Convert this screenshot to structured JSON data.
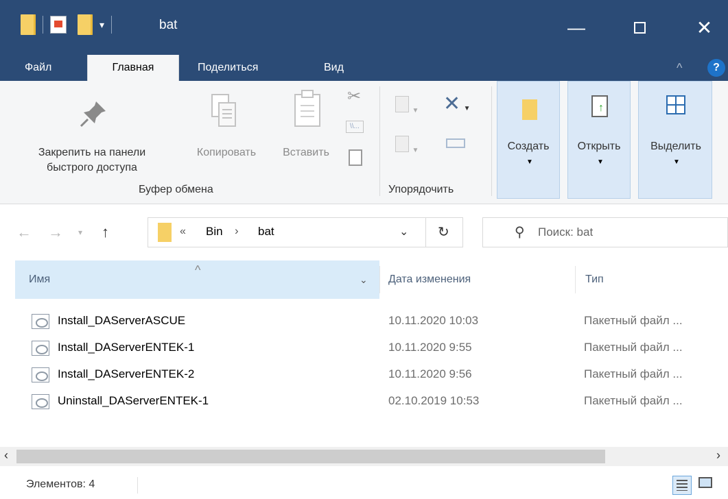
{
  "window": {
    "title": "bat"
  },
  "menu": {
    "tabs": [
      {
        "label": "Файл"
      },
      {
        "label": "Главная"
      },
      {
        "label": "Поделиться"
      },
      {
        "label": "Вид"
      }
    ]
  },
  "ribbon": {
    "clipboard": {
      "pin_label_line1": "Закрепить на панели",
      "pin_label_line2": "быстрого доступа",
      "copy_label": "Копировать",
      "paste_label": "Вставить",
      "group_label": "Буфер обмена"
    },
    "organize": {
      "group_label": "Упорядочить"
    },
    "create_label": "Создать",
    "open_label": "Открыть",
    "select_label": "Выделить"
  },
  "address": {
    "overflow": "«",
    "crumbs": [
      {
        "label": "Bin"
      },
      {
        "label": "bat"
      }
    ],
    "search_placeholder": "Поиск: bat"
  },
  "columns": {
    "name": "Имя",
    "date": "Дата изменения",
    "type": "Тип"
  },
  "files": [
    {
      "name": "Install_DAServerASCUE",
      "date": "10.11.2020 10:03",
      "type": "Пакетный файл ..."
    },
    {
      "name": "Install_DAServerENTEK-1",
      "date": "10.11.2020 9:55",
      "type": "Пакетный файл ..."
    },
    {
      "name": "Install_DAServerENTEK-2",
      "date": "10.11.2020 9:56",
      "type": "Пакетный файл ..."
    },
    {
      "name": "Uninstall_DAServerENTEK-1",
      "date": "02.10.2019 10:53",
      "type": "Пакетный файл ..."
    }
  ],
  "status": {
    "items": "Элементов: 4"
  },
  "colors": {
    "titlebar": "#2b4b76",
    "accent": "#1e73c9",
    "selected_column": "#d9ebf9"
  }
}
